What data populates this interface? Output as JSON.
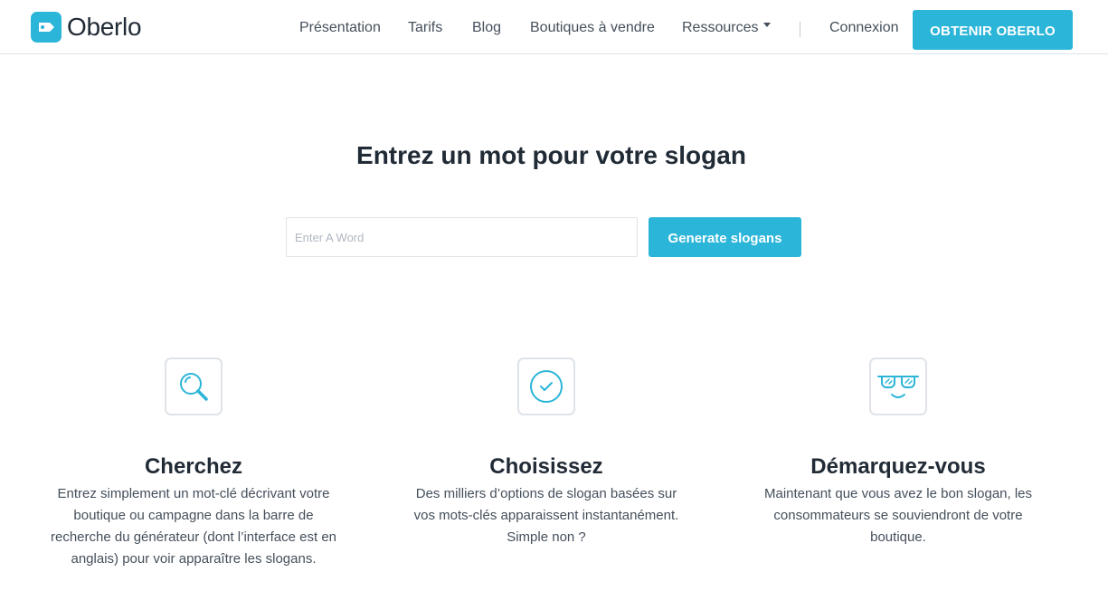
{
  "header": {
    "brand": "Oberlo",
    "nav": {
      "presentation": "Présentation",
      "pricing": "Tarifs",
      "blog": "Blog",
      "stores": "Boutiques à vendre",
      "resources": "Ressources",
      "login": "Connexion"
    },
    "cta_label": "OBTENIR OBERLO"
  },
  "hero": {
    "title": "Entrez un mot pour votre slogan",
    "input_placeholder": "Enter A Word",
    "input_value": "",
    "button_label": "Generate slogans"
  },
  "features": [
    {
      "icon": "magnifier-icon",
      "title": "Cherchez",
      "text": "Entrez simplement un mot-clé décrivant votre boutique ou campagne dans la barre de recherche du générateur (dont l’interface est en anglais) pour voir apparaître les slogans."
    },
    {
      "icon": "check-circle-icon",
      "title": "Choisissez",
      "text": "Des milliers d’options de slogan basées sur vos mots-clés apparaissent instantanément. Simple non ?"
    },
    {
      "icon": "sunglasses-face-icon",
      "title": "Démarquez-vous",
      "text": "Maintenant que vous avez le bon slogan, les consommateurs se souviendront de votre boutique."
    }
  ],
  "colors": {
    "accent": "#2bb5d8",
    "heading": "#212b36",
    "body_text": "#454f5b",
    "border": "#dfe3e8"
  }
}
